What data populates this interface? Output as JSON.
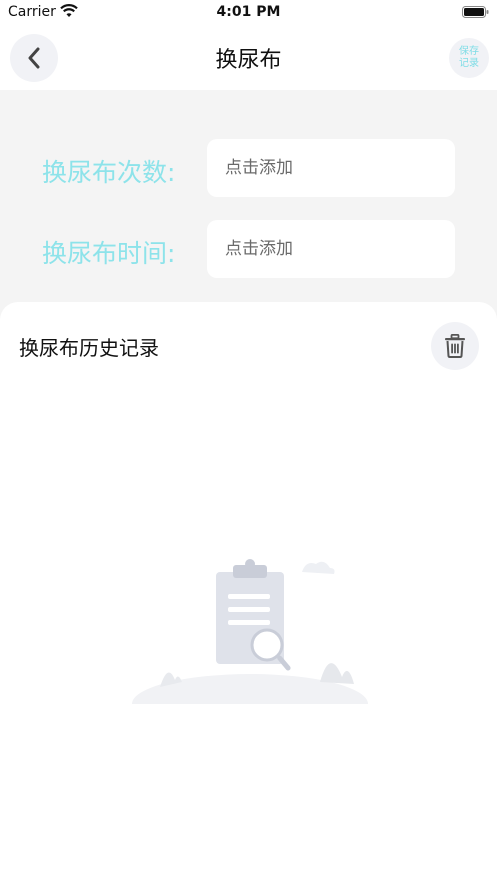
{
  "status_bar": {
    "carrier": "Carrier",
    "time": "4:01 PM"
  },
  "nav": {
    "title": "换尿布",
    "save_line1": "保存",
    "save_line2": "记录",
    "back_icon": "chevron-left-icon"
  },
  "form": {
    "count_label": "换尿布次数:",
    "count_placeholder": "点击添加",
    "time_label": "换尿布时间:",
    "time_placeholder": "点击添加"
  },
  "history": {
    "title": "换尿布历史记录",
    "delete_icon": "trash-icon",
    "empty_icon": "empty-clipboard-icon"
  },
  "colors": {
    "accent": "#8de3ea",
    "button_bg": "#f1f2f6",
    "form_bg": "#f4f4f4"
  }
}
